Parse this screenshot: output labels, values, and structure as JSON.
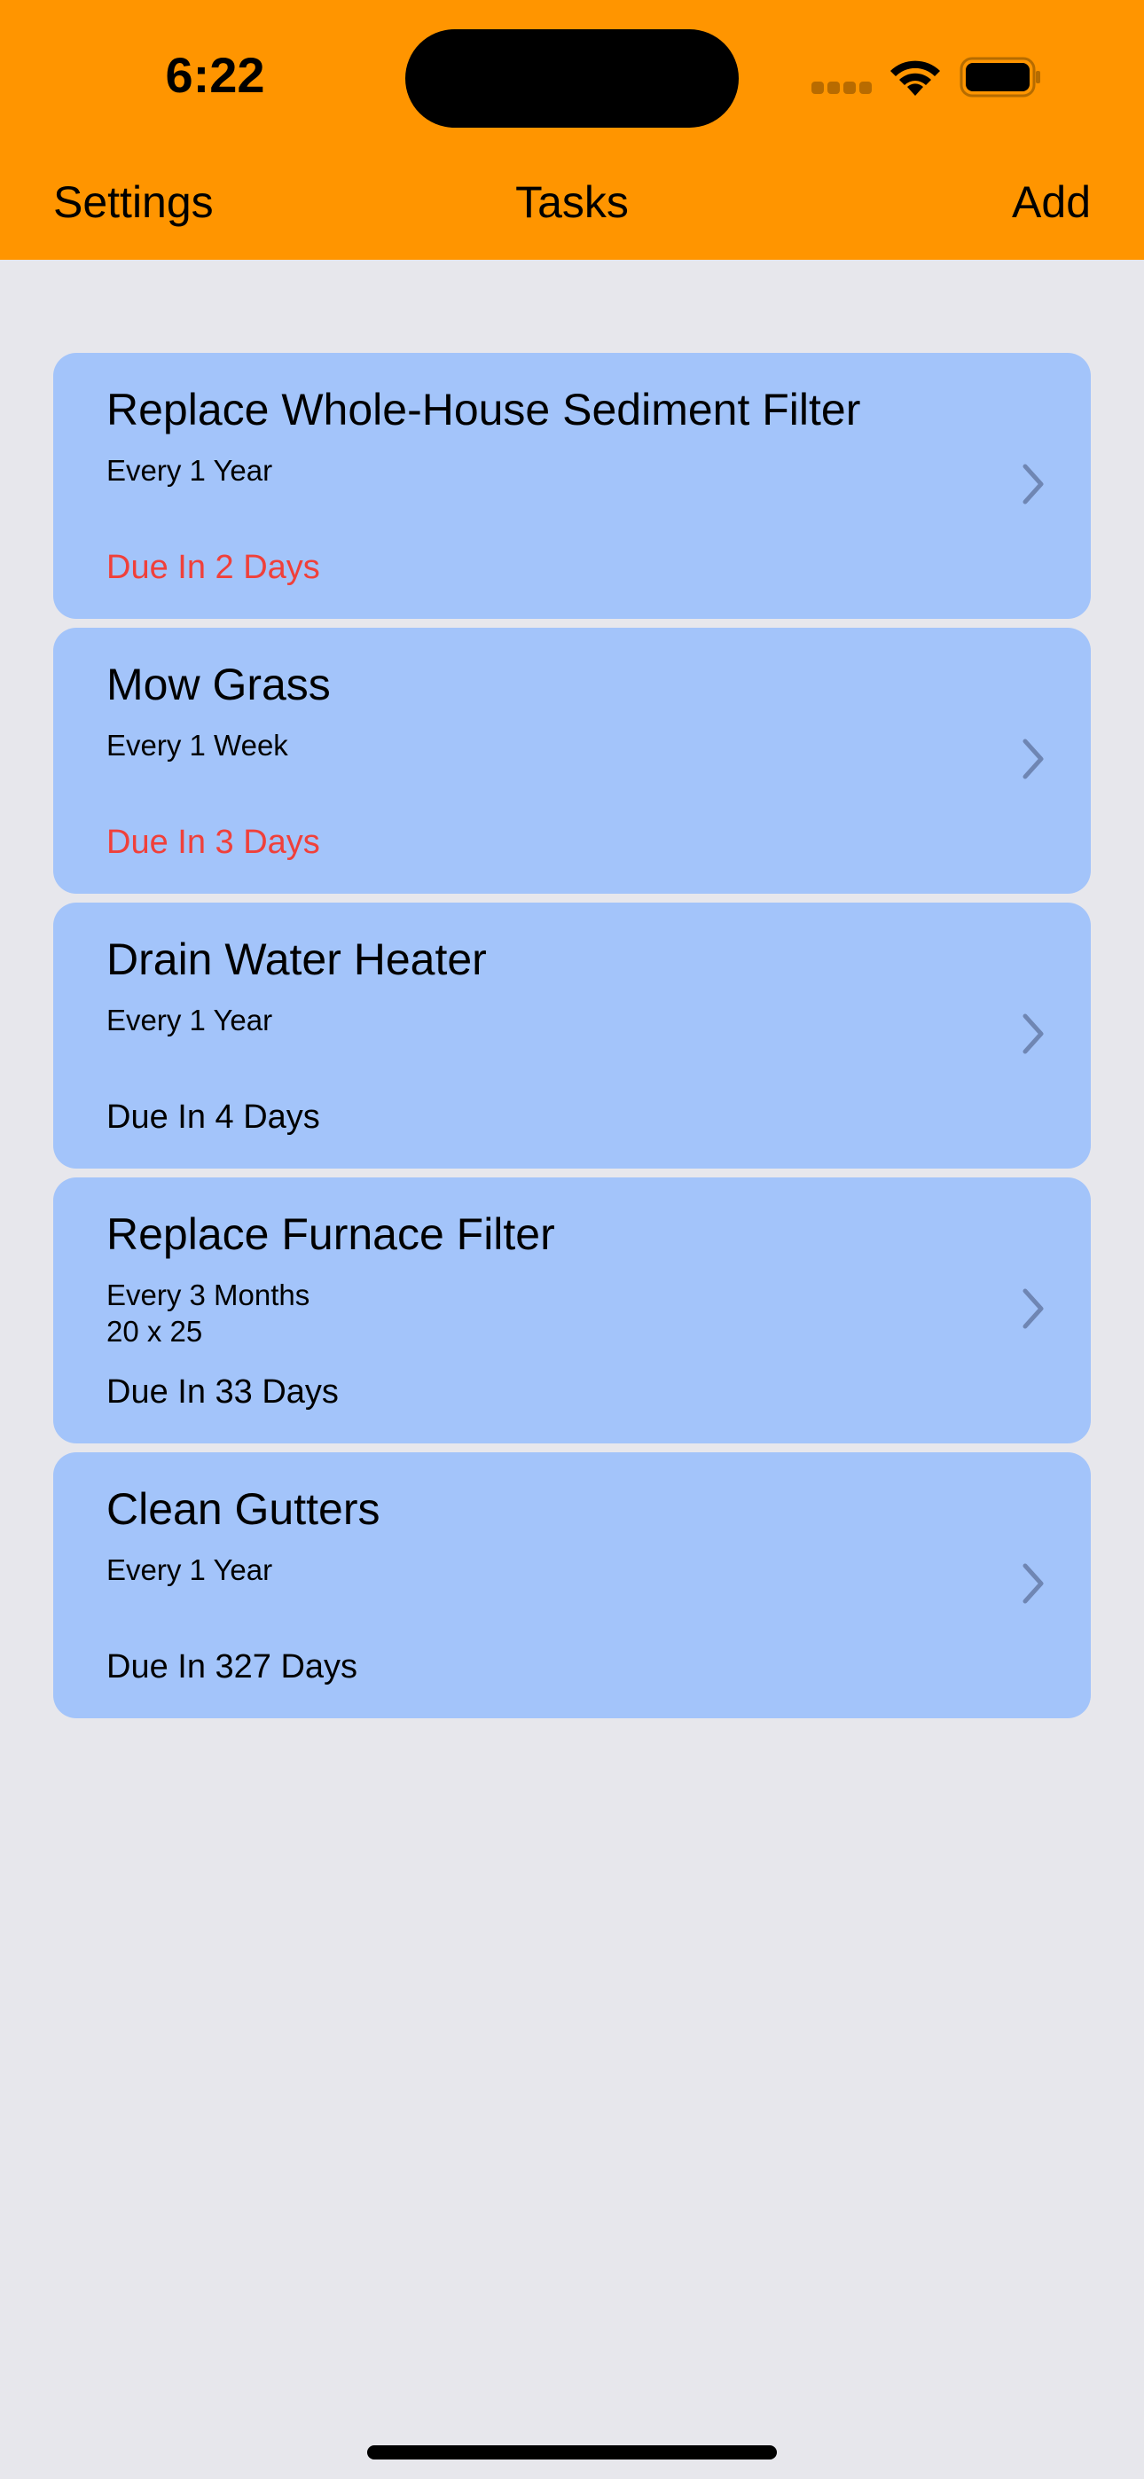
{
  "status_bar": {
    "time": "6:22"
  },
  "nav": {
    "left_label": "Settings",
    "title": "Tasks",
    "right_label": "Add"
  },
  "colors": {
    "header": "#ff9500",
    "background": "#e7e7ec",
    "card": "#a3c4fa",
    "due_urgent": "#f0403a"
  },
  "tasks": [
    {
      "title": "Replace Whole-House Sediment Filter",
      "recurrence": "Every 1 Year",
      "note": "",
      "due": "Due In 2 Days",
      "urgent": true
    },
    {
      "title": "Mow Grass",
      "recurrence": "Every 1 Week",
      "note": "",
      "due": "Due In 3 Days",
      "urgent": true
    },
    {
      "title": "Drain Water Heater",
      "recurrence": "Every 1 Year",
      "note": "",
      "due": "Due In 4 Days",
      "urgent": false
    },
    {
      "title": "Replace Furnace Filter",
      "recurrence": "Every 3 Months",
      "note": "20 x 25",
      "due": "Due In 33 Days",
      "urgent": false
    },
    {
      "title": "Clean Gutters",
      "recurrence": "Every 1 Year",
      "note": "",
      "due": "Due In 327 Days",
      "urgent": false
    }
  ],
  "icons": {
    "row_disclosure": "chevron-right-icon",
    "status": [
      "cellular-signal-icon",
      "wifi-icon",
      "battery-icon"
    ]
  }
}
